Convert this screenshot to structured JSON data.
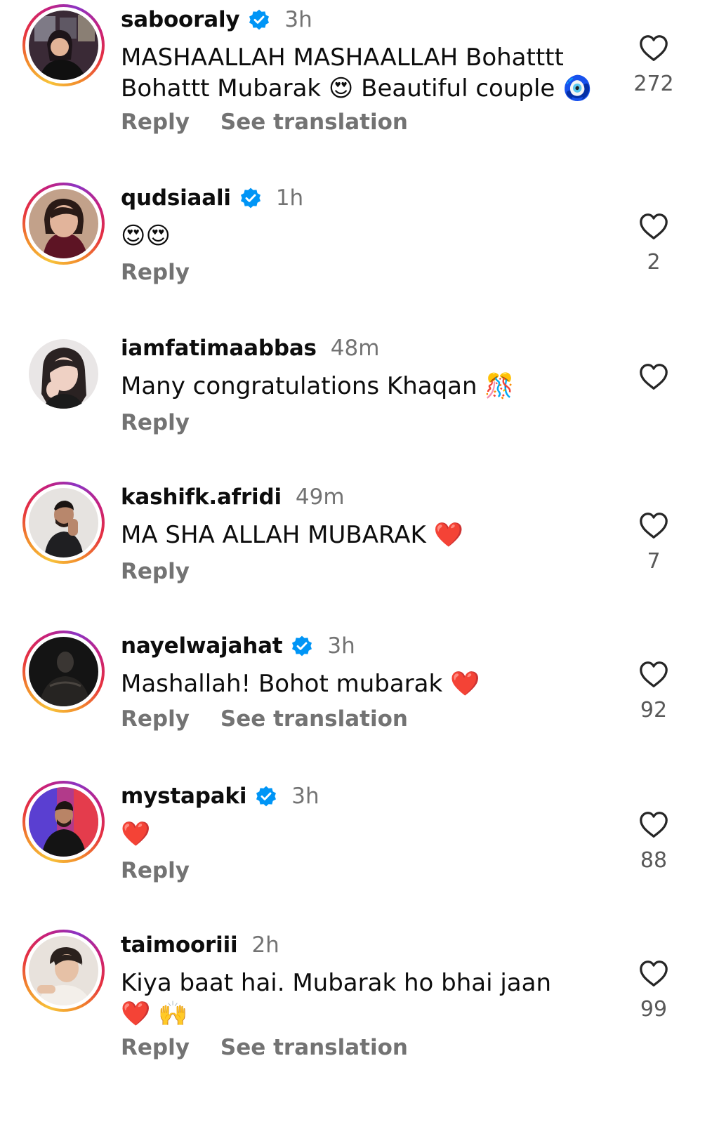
{
  "comments": [
    {
      "username": "sabooraly",
      "verified": true,
      "time": "3h",
      "text": "MASHAALLAH MASHAALLAH Bohatttt Bohattt Mubarak 😍 Beautiful couple 🧿",
      "reply_label": "Reply",
      "translation_label": "See translation",
      "likes": "272",
      "story_ring": true
    },
    {
      "username": "qudsiaali",
      "verified": true,
      "time": "1h",
      "text": "😍😍",
      "reply_label": "Reply",
      "translation_label": "",
      "likes": "2",
      "story_ring": true
    },
    {
      "username": "iamfatimaabbas",
      "verified": false,
      "time": "48m",
      "text": "Many congratulations Khaqan 🎊",
      "reply_label": "Reply",
      "translation_label": "",
      "likes": "",
      "story_ring": false
    },
    {
      "username": "kashifk.afridi",
      "verified": false,
      "time": "49m",
      "text": "MA SHA ALLAH MUBARAK ❤️",
      "reply_label": "Reply",
      "translation_label": "",
      "likes": "7",
      "story_ring": true
    },
    {
      "username": "nayelwajahat",
      "verified": true,
      "time": "3h",
      "text": "Mashallah! Bohot mubarak ❤️",
      "reply_label": "Reply",
      "translation_label": "See translation",
      "likes": "92",
      "story_ring": true
    },
    {
      "username": "mystapaki",
      "verified": true,
      "time": "3h",
      "text": "❤️",
      "reply_label": "Reply",
      "translation_label": "",
      "likes": "88",
      "story_ring": true
    },
    {
      "username": "taimooriii",
      "verified": false,
      "time": "2h",
      "text": "Kiya baat hai. Mubarak ho bhai jaan ❤️ 🙌",
      "reply_label": "Reply",
      "translation_label": "See translation",
      "likes": "99",
      "story_ring": true
    }
  ],
  "icons": {
    "verified": "verified-badge-icon",
    "like": "heart-outline-icon"
  },
  "colors": {
    "verified_blue": "#0095f6",
    "secondary_text": "#737373",
    "primary_text": "#0d0d0d"
  }
}
